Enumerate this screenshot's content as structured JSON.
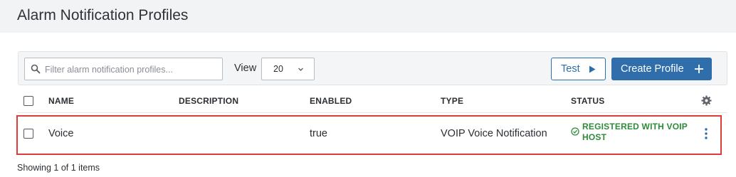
{
  "page": {
    "title": "Alarm Notification Profiles"
  },
  "toolbar": {
    "search_placeholder": "Filter alarm notification profiles...",
    "view_label": "View",
    "view_value": "20",
    "test_label": "Test",
    "create_label": "Create Profile"
  },
  "table": {
    "columns": [
      "NAME",
      "DESCRIPTION",
      "ENABLED",
      "TYPE",
      "STATUS"
    ],
    "rows": [
      {
        "name": "Voice",
        "description": "",
        "enabled": "true",
        "type": "VOIP Voice Notification",
        "status": "REGISTERED WITH VOIP HOST"
      }
    ]
  },
  "footer": {
    "summary": "Showing 1 of 1 items"
  },
  "colors": {
    "primary": "#2f6eab",
    "status_ok": "#2e8b3a",
    "highlight": "#e03b3b"
  },
  "icons": [
    "search-icon",
    "chevron-down-icon",
    "play-icon",
    "plus-icon",
    "gear-icon",
    "check-circle-icon",
    "kebab-menu-icon"
  ]
}
